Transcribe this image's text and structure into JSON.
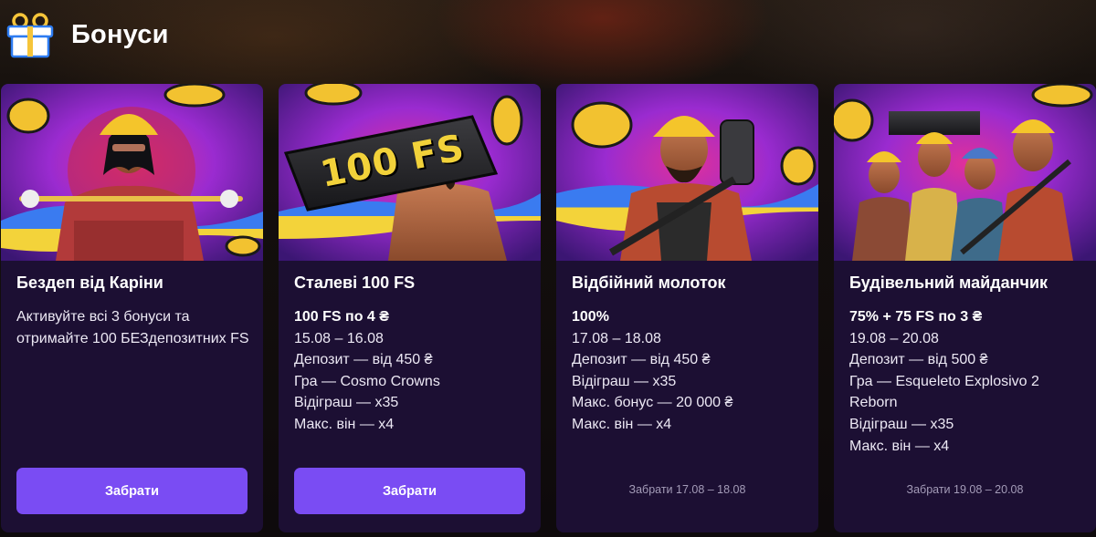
{
  "header": {
    "title": "Бонуси",
    "icon": "gift-icon"
  },
  "colors": {
    "card_bg": "#1c0f33",
    "accent": "#7a4cf3",
    "muted_text": "#a49cb8",
    "page_bg": "#0e0a0c"
  },
  "cards": [
    {
      "title": "Бездеп від Каріни",
      "banner_icon": "worker-woman-image",
      "lines": [
        "Активуйте всі 3 бонуси та отримайте 100 БЕЗдепозитних FS"
      ],
      "button_label": "Забрати"
    },
    {
      "title": "Сталеві 100 FS",
      "banner_icon": "worker-steel-beam-image",
      "banner_text": "100 FS",
      "headline": "100 FS по 4 ₴",
      "lines": [
        "15.08 – 16.08",
        "Депозит — від 450 ₴",
        "Гра — Cosmo Crowns",
        "Відіграш — х35",
        "Макс. він — х4"
      ],
      "button_label": "Забрати"
    },
    {
      "title": "Відбійний молоток",
      "banner_icon": "worker-jackhammer-image",
      "headline": "100%",
      "lines": [
        "17.08 – 18.08",
        "Депозит — від 450 ₴",
        "Відіграш — х35",
        "Макс. бонус — 20 000 ₴",
        "Макс. він — х4"
      ],
      "claim_period": "Забрати 17.08 – 18.08"
    },
    {
      "title": "Будівельний майданчик",
      "banner_icon": "worker-team-image",
      "headline": "75% + 75 FS по 3 ₴",
      "lines": [
        "19.08 – 20.08",
        "Депозит — від 500 ₴",
        "Гра — Esqueleto Explosivo 2 Reborn",
        "Відіграш — х35",
        "Макс. він — х4"
      ],
      "claim_period": "Забрати 19.08 – 20.08"
    }
  ]
}
